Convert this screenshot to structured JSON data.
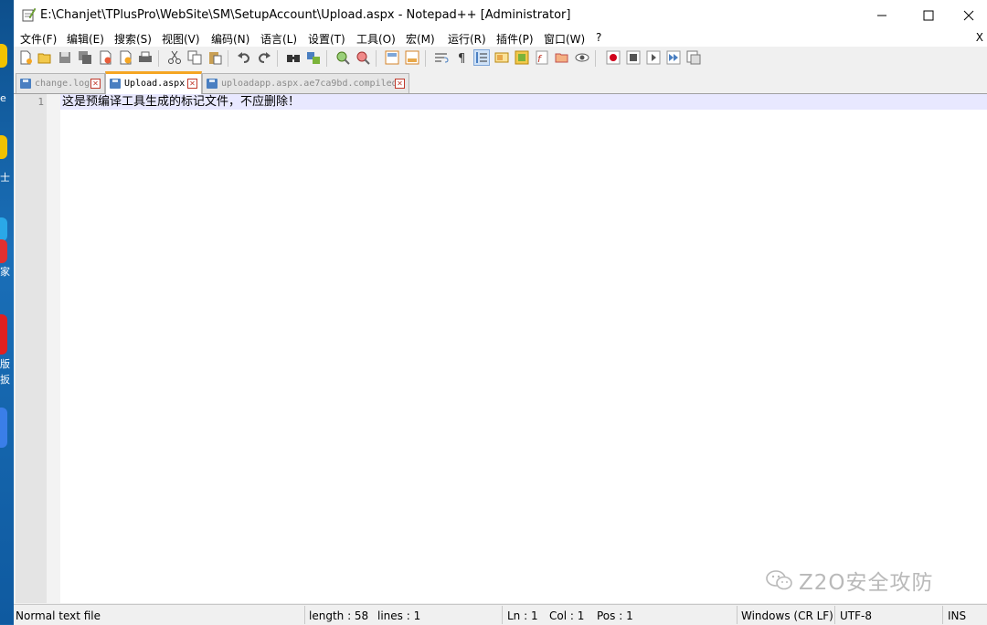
{
  "window": {
    "title": "E:\\Chanjet\\TPlusPro\\WebSite\\SM\\SetupAccount\\Upload.aspx - Notepad++ [Administrator]"
  },
  "desktop": {
    "labels": [
      "e",
      "士",
      "家",
      "版",
      "扳"
    ]
  },
  "menu": {
    "items": [
      "文件(F)",
      "编辑(E)",
      "搜索(S)",
      "视图(V)",
      "编码(N)",
      "语言(L)",
      "设置(T)",
      "工具(O)",
      "宏(M)",
      "运行(R)",
      "插件(P)",
      "窗口(W)",
      "?"
    ],
    "close_doc": "X"
  },
  "toolbar": {
    "icons": [
      "new-file-icon",
      "open-file-icon",
      "save-icon",
      "save-all-icon",
      "close-icon",
      "close-all-icon",
      "print-icon",
      "cut-icon",
      "copy-icon",
      "paste-icon",
      "undo-icon",
      "redo-icon",
      "find-icon",
      "replace-icon",
      "zoom-in-icon",
      "zoom-out-icon",
      "sync-vertical-icon",
      "sync-horizontal-icon",
      "word-wrap-icon",
      "show-all-chars-icon",
      "indent-guide-icon",
      "lang-udl-icon",
      "doc-map-icon",
      "function-list-icon",
      "folder-workspace-icon",
      "monitor-icon",
      "record-macro-icon",
      "stop-record-icon",
      "play-macro-icon",
      "run-macro-multiple-icon",
      "save-macro-icon"
    ]
  },
  "tabs": [
    {
      "label": "change.log",
      "active": false
    },
    {
      "label": "Upload.aspx",
      "active": true
    },
    {
      "label": "uploadapp.aspx.ae7ca9bd.compiled",
      "active": false
    }
  ],
  "editor": {
    "line_number": "1",
    "content": "这是预编译工具生成的标记文件，不应删除！"
  },
  "watermark": {
    "text": "Z2O安全攻防"
  },
  "status": {
    "file_type": "Normal text file",
    "length": "length : 58",
    "lines": "lines : 1",
    "ln": "Ln : 1",
    "col": "Col : 1",
    "pos": "Pos : 1",
    "eol": "Windows (CR LF)",
    "encoding": "UTF-8",
    "mode": "INS"
  },
  "colors": {
    "active_tab_accent": "#f5a623",
    "current_line": "#e8e8ff",
    "desktop_bg": "#1565a8"
  }
}
